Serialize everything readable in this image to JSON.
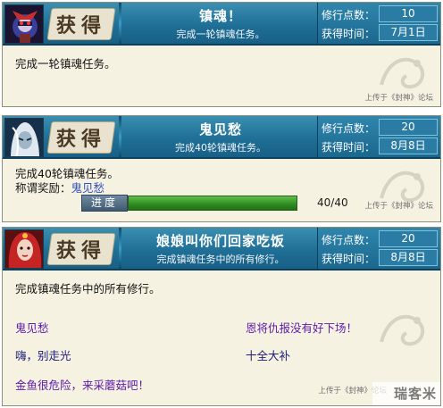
{
  "achievements": [
    {
      "stamp": "获得",
      "title": "镇魂！",
      "subtitle": "完成一轮镇魂任务。",
      "points_label": "修行点数：",
      "points": "10",
      "time_label": "获得时间：",
      "time": "7月1日",
      "description": "完成一轮镇魂任务。",
      "upload_note": "上传于《封神》论坛"
    },
    {
      "stamp": "获得",
      "title": "鬼见愁",
      "subtitle": "完成40轮镇魂任务。",
      "points_label": "修行点数：",
      "points": "20",
      "time_label": "获得时间：",
      "time": "8月8日",
      "description": "完成40轮镇魂任务。",
      "reward_label": "称谓奖励：",
      "reward_title": "鬼见愁",
      "progress_label": "进度",
      "progress_current": 40,
      "progress_total": 40,
      "progress_text": "40/40",
      "upload_note": "上传于《封神》论坛"
    },
    {
      "stamp": "获得",
      "title": "娘娘叫你们回家吃饭",
      "subtitle": "完成镇魂任务中的所有修行。",
      "points_label": "修行点数：",
      "points": "20",
      "time_label": "获得时间：",
      "time": "8月8日",
      "description": "完成镇魂任务中的所有修行。",
      "rewards": [
        "鬼见愁",
        "恩将仇报没有好下场！",
        "嗨，别走光",
        "十全大补",
        "金鱼很危险，来采蘑菇吧！"
      ],
      "upload_note": "上传于《封神》论坛"
    }
  ],
  "corner_watermark": "瑞客米",
  "colors": {
    "header_blue": "#1f6f96",
    "card_bg": "#f6f2e2",
    "progress_green": "#2e8a21",
    "reward_purple": "#5a1aa8",
    "link_blue": "#2f4fbf"
  }
}
